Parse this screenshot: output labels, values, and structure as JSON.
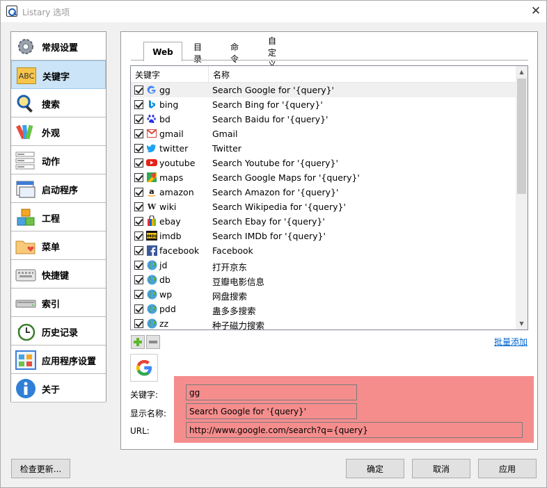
{
  "window": {
    "title": "Listary 选项",
    "close_glyph": "✕"
  },
  "sidebar": {
    "items": [
      {
        "label": "常规设置",
        "icon": "gear-icon"
      },
      {
        "label": "关键字",
        "icon": "abc-icon",
        "active": true
      },
      {
        "label": "搜索",
        "icon": "magnifier-icon"
      },
      {
        "label": "外观",
        "icon": "palette-icon"
      },
      {
        "label": "动作",
        "icon": "action-list-icon"
      },
      {
        "label": "启动程序",
        "icon": "window-launch-icon"
      },
      {
        "label": "工程",
        "icon": "cubes-icon"
      },
      {
        "label": "菜单",
        "icon": "folder-heart-icon"
      },
      {
        "label": "快捷键",
        "icon": "keyboard-icon"
      },
      {
        "label": "索引",
        "icon": "drive-icon"
      },
      {
        "label": "历史记录",
        "icon": "clock-icon"
      },
      {
        "label": "应用程序设置",
        "icon": "app-grid-icon"
      },
      {
        "label": "关于",
        "icon": "info-icon"
      }
    ]
  },
  "tabs": [
    {
      "label": "Web",
      "active": true
    },
    {
      "label": "目录"
    },
    {
      "label": "命令"
    },
    {
      "label": "自定义"
    }
  ],
  "list": {
    "headers": {
      "keyword": "关键字",
      "name": "名称"
    },
    "rows": [
      {
        "key": "gg",
        "name": "Search Google for '{query}'",
        "icon": "google-icon",
        "selected": true
      },
      {
        "key": "bing",
        "name": "Search Bing for '{query}'",
        "icon": "bing-icon"
      },
      {
        "key": "bd",
        "name": "Search Baidu for '{query}'",
        "icon": "baidu-icon"
      },
      {
        "key": "gmail",
        "name": "Gmail",
        "icon": "gmail-icon"
      },
      {
        "key": "twitter",
        "name": "Twitter",
        "icon": "twitter-icon"
      },
      {
        "key": "youtube",
        "name": "Search Youtube for '{query}'",
        "icon": "youtube-icon"
      },
      {
        "key": "maps",
        "name": "Search Google Maps for '{query}'",
        "icon": "maps-icon"
      },
      {
        "key": "amazon",
        "name": "Search Amazon for '{query}'",
        "icon": "amazon-icon"
      },
      {
        "key": "wiki",
        "name": "Search Wikipedia for '{query}'",
        "icon": "wikipedia-icon"
      },
      {
        "key": "ebay",
        "name": "Search Ebay for '{query}'",
        "icon": "ebay-icon"
      },
      {
        "key": "imdb",
        "name": "Search IMDb for '{query}'",
        "icon": "imdb-icon"
      },
      {
        "key": "facebook",
        "name": "Facebook",
        "icon": "facebook-icon"
      },
      {
        "key": "jd",
        "name": "打开京东",
        "icon": "globe-icon"
      },
      {
        "key": "db",
        "name": "豆瓣电影信息",
        "icon": "globe-icon"
      },
      {
        "key": "wp",
        "name": "网盘搜索",
        "icon": "globe-icon"
      },
      {
        "key": "pdd",
        "name": "蛊多多搜索",
        "icon": "globe-icon"
      },
      {
        "key": "zz",
        "name": "种子磁力搜索",
        "icon": "globe-icon"
      }
    ]
  },
  "batch_add": "批量添加",
  "detail": {
    "keyword_label": "关键字:",
    "keyword_value": "gg",
    "display_label": "显示名称:",
    "display_value": "Search Google for '{query}'",
    "url_label": "URL:",
    "url_value": "http://www.google.com/search?q={query}"
  },
  "buttons": {
    "check_update": "检查更新...",
    "ok": "确定",
    "cancel": "取消",
    "apply": "应用"
  }
}
